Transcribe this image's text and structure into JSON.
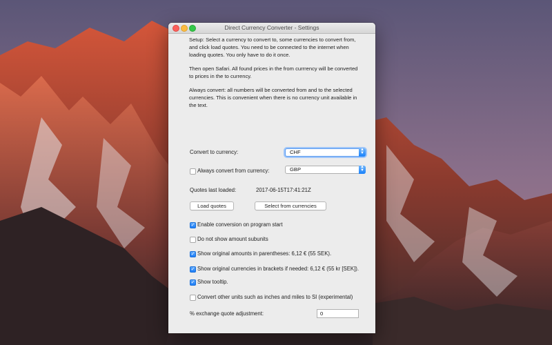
{
  "window": {
    "title": "Direct Currency Converter -  Settings"
  },
  "text": {
    "setup": "Setup: Select a currency to convert to, some currencies to convert from, and click load quotes. You need to be connected to the internet when loading quotes. You only have to do it once.",
    "safari": "Then open Safari. All found prices in the from currrency will be converted to prices in the to currency.",
    "always": "Always convert: all numbers will be converted from and to the selected currencies. This is convenient when there is no currency unit available in the text."
  },
  "convert_to": {
    "label": "Convert to currency:",
    "value": "CHF"
  },
  "always_convert": {
    "label": "Always convert from currency:",
    "checked": false,
    "value": "GBP"
  },
  "quotes": {
    "label": "Quotes last loaded:",
    "value": "2017-06-15T17:41:21Z",
    "load_button": "Load quotes",
    "select_button": "Select from currencies"
  },
  "options": [
    {
      "label": "Enable conversion on program start",
      "checked": true
    },
    {
      "label": "Do not show amount subunits",
      "checked": false
    },
    {
      "label": "Show original amounts in parentheses: 6,12 € (55 SEK).",
      "checked": true
    },
    {
      "label": "Show original currencies in brackets if needed: 6,12 € (55 kr [SEK]).",
      "checked": true
    },
    {
      "label": "Show tooltip.",
      "checked": true
    },
    {
      "label": "Convert other units such as inches and miles to SI (experimental)",
      "checked": false
    }
  ],
  "adjustment": {
    "label": "% exchange quote adjustment:",
    "value": "0"
  },
  "colors": {
    "accent": "#1d7ef7",
    "window_bg": "#ececec"
  }
}
